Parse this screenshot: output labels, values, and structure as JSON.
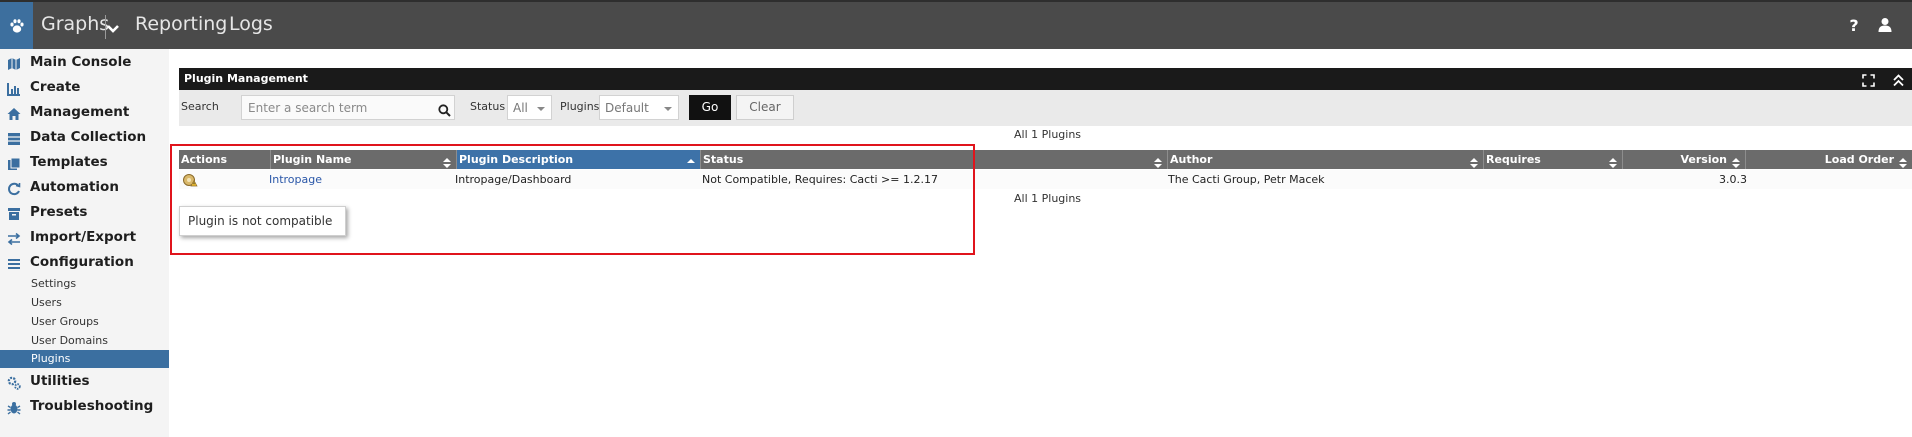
{
  "topbar": {
    "tabs": [
      {
        "label": "Graphs"
      },
      {
        "label": "Reporting"
      },
      {
        "label": "Logs"
      }
    ],
    "help_label": "?",
    "icons": {
      "logo": "paw-icon",
      "dropdown": "chevron-down-icon",
      "help": "help-icon",
      "user": "user-icon"
    }
  },
  "sidebar": {
    "menus": [
      {
        "label": "Main Console",
        "icon": "map-icon"
      },
      {
        "label": "Create",
        "icon": "chart-icon"
      },
      {
        "label": "Management",
        "icon": "home-icon"
      },
      {
        "label": "Data Collection",
        "icon": "database-icon"
      },
      {
        "label": "Templates",
        "icon": "copy-icon"
      },
      {
        "label": "Automation",
        "icon": "refresh-icon"
      },
      {
        "label": "Presets",
        "icon": "archive-icon"
      },
      {
        "label": "Import/Export",
        "icon": "exchange-icon"
      },
      {
        "label": "Configuration",
        "icon": "sliders-icon"
      }
    ],
    "config_items": [
      {
        "label": "Settings"
      },
      {
        "label": "Users"
      },
      {
        "label": "User Groups"
      },
      {
        "label": "User Domains"
      },
      {
        "label": "Plugins",
        "active": true
      }
    ],
    "bottom_menus": [
      {
        "label": "Utilities",
        "icon": "cogs-icon"
      },
      {
        "label": "Troubleshooting",
        "icon": "bug-icon"
      }
    ]
  },
  "panel": {
    "title": "Plugin Management",
    "filters": {
      "search_label": "Search",
      "search_placeholder": "Enter a search term",
      "status_label": "Status",
      "status_value": "All",
      "plugins_label": "Plugins",
      "plugins_value": "Default",
      "go_label": "Go",
      "clear_label": "Clear"
    },
    "count_top": "All 1 Plugins",
    "count_bottom": "All 1 Plugins",
    "columns": [
      {
        "label": "Actions"
      },
      {
        "label": "Plugin Name"
      },
      {
        "label": "Plugin Description"
      },
      {
        "label": "Status"
      },
      {
        "label": "Author"
      },
      {
        "label": "Requires"
      },
      {
        "label": "Version"
      },
      {
        "label": "Load Order"
      }
    ],
    "rows": [
      {
        "action_icon": "plugin-warning-icon",
        "name": "Intropage",
        "description": "Intropage/Dashboard",
        "status": "Not Compatible, Requires: Cacti >= 1.2.17",
        "author": "The Cacti Group, Petr Macek",
        "requires": "",
        "version": "3.0.3",
        "load_order": ""
      }
    ],
    "tooltip": "Plugin is not compatible"
  },
  "colors": {
    "topbar": "#4a4a4a",
    "accent": "#3b6fa0",
    "panel_header": "#1a1a1a",
    "table_header": "#6b6b6b",
    "highlight": "#e0141c"
  }
}
